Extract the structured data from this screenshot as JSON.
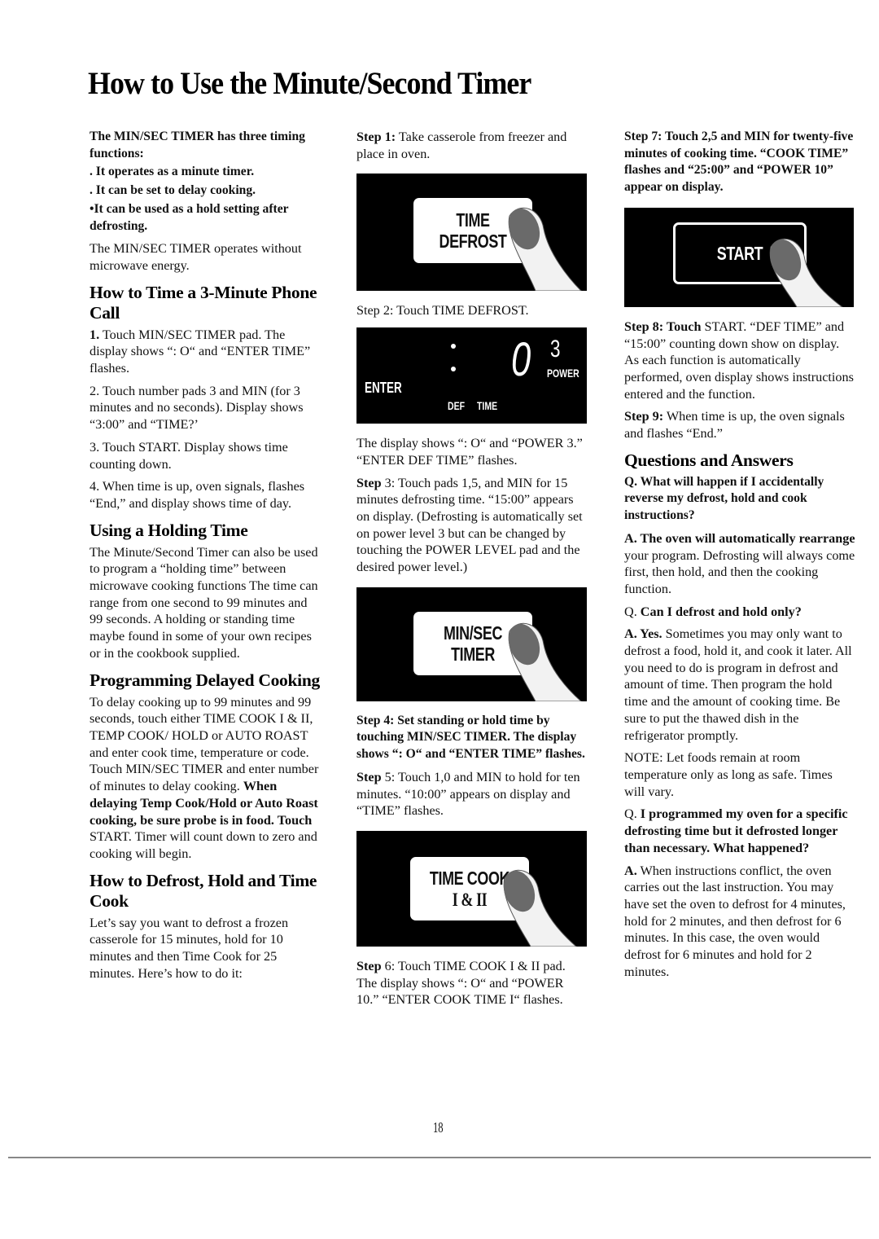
{
  "page": {
    "title": "How to Use the Minute/Second Timer",
    "page_number": "18"
  },
  "column1": {
    "intro_heading": "The MIN/SEC TIMER has three timing functions:",
    "functions": [
      ". It operates as a minute timer.",
      ". It can be set to delay cooking.",
      "•It can be used as a hold setting after defrosting."
    ],
    "intro_note": "The MIN/SEC TIMER operates without microwave energy.",
    "phone_call": {
      "heading": "How to Time a 3-Minute Phone Call",
      "steps": [
        {
          "num": "1.",
          "text": " Touch MIN/SEC TIMER pad. The display shows “: O“ and “ENTER TIME” flashes."
        },
        {
          "num": "2.",
          "text": " Touch number pads 3 and MIN (for 3 minutes and no seconds). Display shows “3:00” and “TIME?’"
        },
        {
          "num": "3.",
          "text": " Touch START. Display shows time counting down."
        },
        {
          "num": "4.",
          "text": " When time is up, oven signals, flashes “End,” and display shows time of day."
        }
      ]
    },
    "holding_time": {
      "heading": "Using a Holding Time",
      "body": "The Minute/Second Timer can also be used to program a “holding time” between microwave cooking functions The time can range from one second to 99 minutes and 99 seconds. A holding or standing time maybe found in some of your own recipes or in the cookbook supplied."
    },
    "delayed_cooking": {
      "heading": "Programming Delayed Cooking",
      "body": "To delay cooking up to 99 minutes and 99 seconds, touch either TIME COOK I & II, TEMP COOK/ HOLD or AUTO ROAST and enter cook time, temperature or code. Touch MIN/SEC TIMER and enter number of minutes to delay cooking. ",
      "bold_part": "When delaying Temp Cook/Hold or Auto Roast cooking, be sure probe is in food. Touch",
      "tail": " START. Timer will count down to zero and cooking will begin."
    },
    "defrost_hold_cook": {
      "heading": "How to Defrost, Hold and Time Cook",
      "body": "Let’s say you want to defrost a frozen casserole for 15 minutes, hold for 10 minutes and then Time Cook for 25 minutes. Here’s how to do it:"
    }
  },
  "column2": {
    "step1": {
      "label": "Step 1:",
      "text": " Take casserole from freezer and place in oven."
    },
    "pad_time_defrost": {
      "line1": "TIME",
      "line2": "DEFROST"
    },
    "step2": {
      "text": "Step 2: Touch TIME DEFROST."
    },
    "display": {
      "enter": "ENTER",
      "digit1": "0",
      "digit2": "3",
      "power": "POWER",
      "def": "DEF",
      "time": "TIME"
    },
    "display_note": "The display shows “: O“ and “POWER 3.” “ENTER DEF TIME” flashes.",
    "step3": {
      "label": "Step",
      "text": " 3: Touch pads 1,5, and MIN for 15 minutes defrosting time. “15:00” appears on display. (Defrosting is automatically set on power level 3 but can be changed by touching the POWER LEVEL pad and the desired power level.)"
    },
    "pad_min_sec": {
      "line1": "MIN/SEC",
      "line2": "TIMER"
    },
    "step4": {
      "text": "Step 4: Set standing or hold time by touching MIN/SEC TIMER. The display shows “: O“ and “ENTER TIME” flashes."
    },
    "step5": {
      "label": "Step",
      "text": " 5: Touch 1,0 and MIN to hold for ten minutes. “10:00” appears on display and “TIME” flashes."
    },
    "pad_time_cook": {
      "line1": "TIME COOK",
      "line2": "I & II"
    },
    "step6": {
      "label": "Step",
      "text": " 6: Touch TIME COOK I & II pad. The display shows “: O“ and “POWER 10.” “ENTER COOK TIME I“ flashes."
    }
  },
  "column3": {
    "step7": {
      "text": "Step 7: Touch 2,5 and MIN for twenty-five minutes of cooking time. “COOK TIME” flashes and “25:00” and “POWER 10” appear on display."
    },
    "pad_start": {
      "line1": "START"
    },
    "step8": {
      "label": "Step 8: Touch",
      "text": " START. “DEF TIME” and “15:00” counting down show on display. As each function is automatically performed, oven display shows instructions entered and the function."
    },
    "step9": {
      "label": "Step 9:",
      "text": " When time is up, the oven signals and flashes “End.”"
    },
    "qa": {
      "heading": "Questions and Answers",
      "items": [
        {
          "q_prefix": "Q.",
          "q": " What will happen if I accidentally reverse my defrost, hold and cook instructions?",
          "a_bold": "A. The oven will automatically rearrange",
          "a": " your program. Defrosting will always come first, then hold, and then the cooking function."
        },
        {
          "q_prefix": "Q.",
          "q": " Can I defrost and hold only?",
          "a_bold": "A. Yes.",
          "a": " Sometimes you may only want to defrost a food, hold it, and cook it later. All you need to do is program in defrost and amount of time. Then program the hold time and the amount of cooking time. Be sure to put the thawed dish in the refrigerator promptly."
        },
        {
          "note": "NOTE: Let foods remain at room temperature only as long as safe. Times will vary."
        },
        {
          "q_prefix": "Q.",
          "q": " I programmed my oven for a specific defrosting time but it defrosted longer than necessary. What happened?",
          "a_bold": "A.",
          "a": " When instructions conflict, the oven carries out the last instruction. You may have set the oven to defrost for 4 minutes, hold for 2 minutes, and then defrost for 6 minutes. In this case, the oven would defrost for 6 minutes and hold for 2 minutes."
        }
      ]
    }
  }
}
